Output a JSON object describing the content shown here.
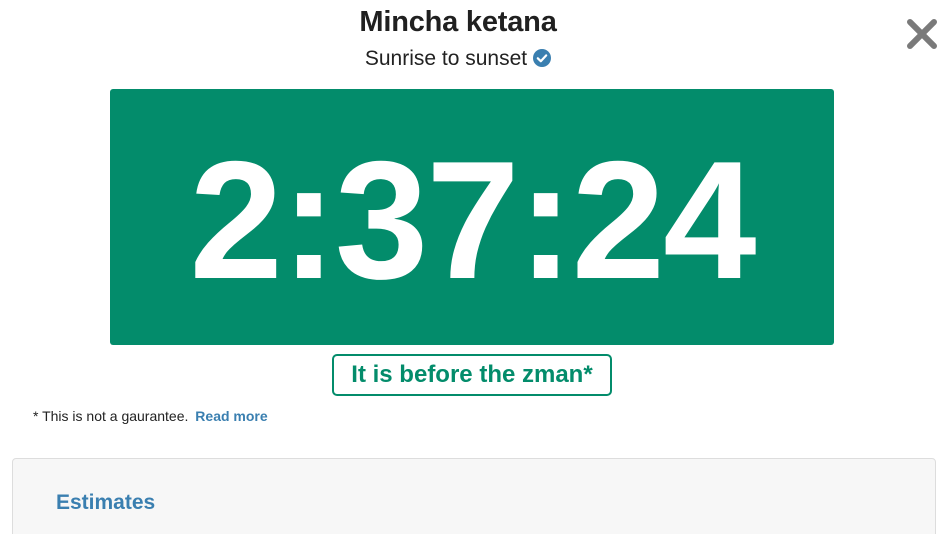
{
  "header": {
    "title": "Mincha ketana",
    "subtitle": "Sunrise to sunset",
    "close_icon": "close-icon",
    "verified_icon": "check-circle-icon"
  },
  "timer": {
    "value": "2:37:24",
    "background_color": "#038c6b"
  },
  "status": {
    "label": "It is before the zman*",
    "color": "#038c6b"
  },
  "disclaimer": {
    "text": "* This is not a gaurantee.",
    "link_label": "Read more",
    "link_color": "#3a7fb0"
  },
  "estimates": {
    "heading": "Estimates"
  }
}
